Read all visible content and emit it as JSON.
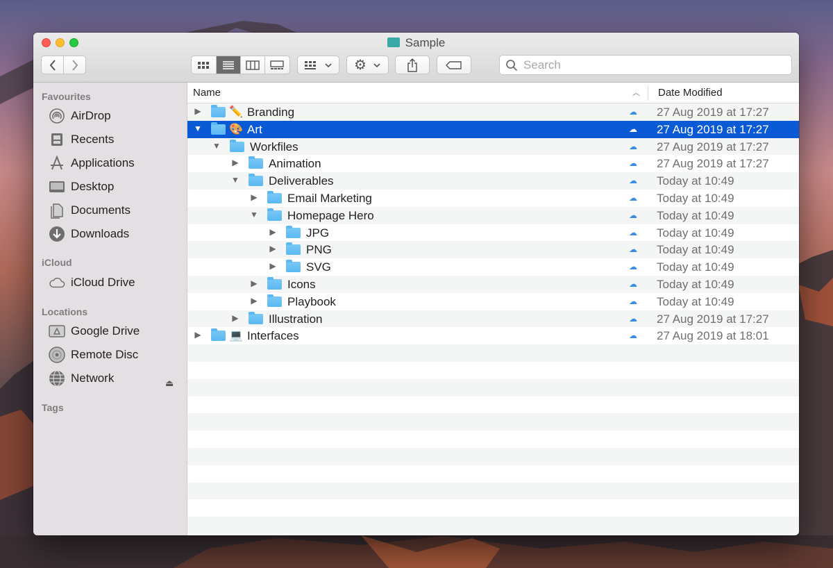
{
  "window": {
    "title": "Sample"
  },
  "toolbar": {
    "back_icon": "chevron-left-icon",
    "forward_icon": "chevron-right-icon",
    "view_modes": [
      "icon-view",
      "list-view",
      "column-view",
      "gallery-view"
    ],
    "active_view": "list-view",
    "search_placeholder": "Search"
  },
  "sidebar": {
    "favourites_header": "Favourites",
    "favourites": [
      {
        "label": "AirDrop",
        "icon": "airdrop-icon"
      },
      {
        "label": "Recents",
        "icon": "recents-icon"
      },
      {
        "label": "Applications",
        "icon": "applications-icon"
      },
      {
        "label": "Desktop",
        "icon": "desktop-icon"
      },
      {
        "label": "Documents",
        "icon": "documents-icon"
      },
      {
        "label": "Downloads",
        "icon": "downloads-icon"
      }
    ],
    "icloud_header": "iCloud",
    "icloud": [
      {
        "label": "iCloud Drive",
        "icon": "cloud-icon"
      }
    ],
    "locations_header": "Locations",
    "locations": [
      {
        "label": "Google Drive",
        "icon": "drive-icon"
      },
      {
        "label": "Remote Disc",
        "icon": "disc-icon"
      },
      {
        "label": "Network",
        "icon": "network-icon"
      }
    ],
    "tags_header": "Tags"
  },
  "columns": {
    "name": "Name",
    "date": "Date Modified"
  },
  "files": [
    {
      "name": "Branding",
      "date": "27 Aug 2019 at 17:27",
      "depth": 0,
      "expanded": false,
      "emoji": "✏️",
      "selected": false
    },
    {
      "name": "Art",
      "date": "27 Aug 2019 at 17:27",
      "depth": 0,
      "expanded": true,
      "emoji": "🎨",
      "selected": true
    },
    {
      "name": "Workfiles",
      "date": "27 Aug 2019 at 17:27",
      "depth": 1,
      "expanded": true,
      "emoji": "",
      "selected": false
    },
    {
      "name": "Animation",
      "date": "27 Aug 2019 at 17:27",
      "depth": 2,
      "expanded": false,
      "emoji": "",
      "selected": false
    },
    {
      "name": "Deliverables",
      "date": "Today at 10:49",
      "depth": 2,
      "expanded": true,
      "emoji": "",
      "selected": false
    },
    {
      "name": "Email Marketing",
      "date": "Today at 10:49",
      "depth": 3,
      "expanded": false,
      "emoji": "",
      "selected": false
    },
    {
      "name": "Homepage Hero",
      "date": "Today at 10:49",
      "depth": 3,
      "expanded": true,
      "emoji": "",
      "selected": false
    },
    {
      "name": "JPG",
      "date": "Today at 10:49",
      "depth": 4,
      "expanded": false,
      "emoji": "",
      "selected": false
    },
    {
      "name": "PNG",
      "date": "Today at 10:49",
      "depth": 4,
      "expanded": false,
      "emoji": "",
      "selected": false
    },
    {
      "name": "SVG",
      "date": "Today at 10:49",
      "depth": 4,
      "expanded": false,
      "emoji": "",
      "selected": false
    },
    {
      "name": "Icons",
      "date": "Today at 10:49",
      "depth": 3,
      "expanded": false,
      "emoji": "",
      "selected": false
    },
    {
      "name": "Playbook",
      "date": "Today at 10:49",
      "depth": 3,
      "expanded": false,
      "emoji": "",
      "selected": false
    },
    {
      "name": "Illustration",
      "date": "27 Aug 2019 at 17:27",
      "depth": 2,
      "expanded": false,
      "emoji": "",
      "selected": false
    },
    {
      "name": "Interfaces",
      "date": "27 Aug 2019 at 18:01",
      "depth": 0,
      "expanded": false,
      "emoji": "💻",
      "selected": false
    }
  ],
  "colors": {
    "selection": "#0a5ad6",
    "folder": "#5ab8f2",
    "cloud": "#3a8de2"
  }
}
